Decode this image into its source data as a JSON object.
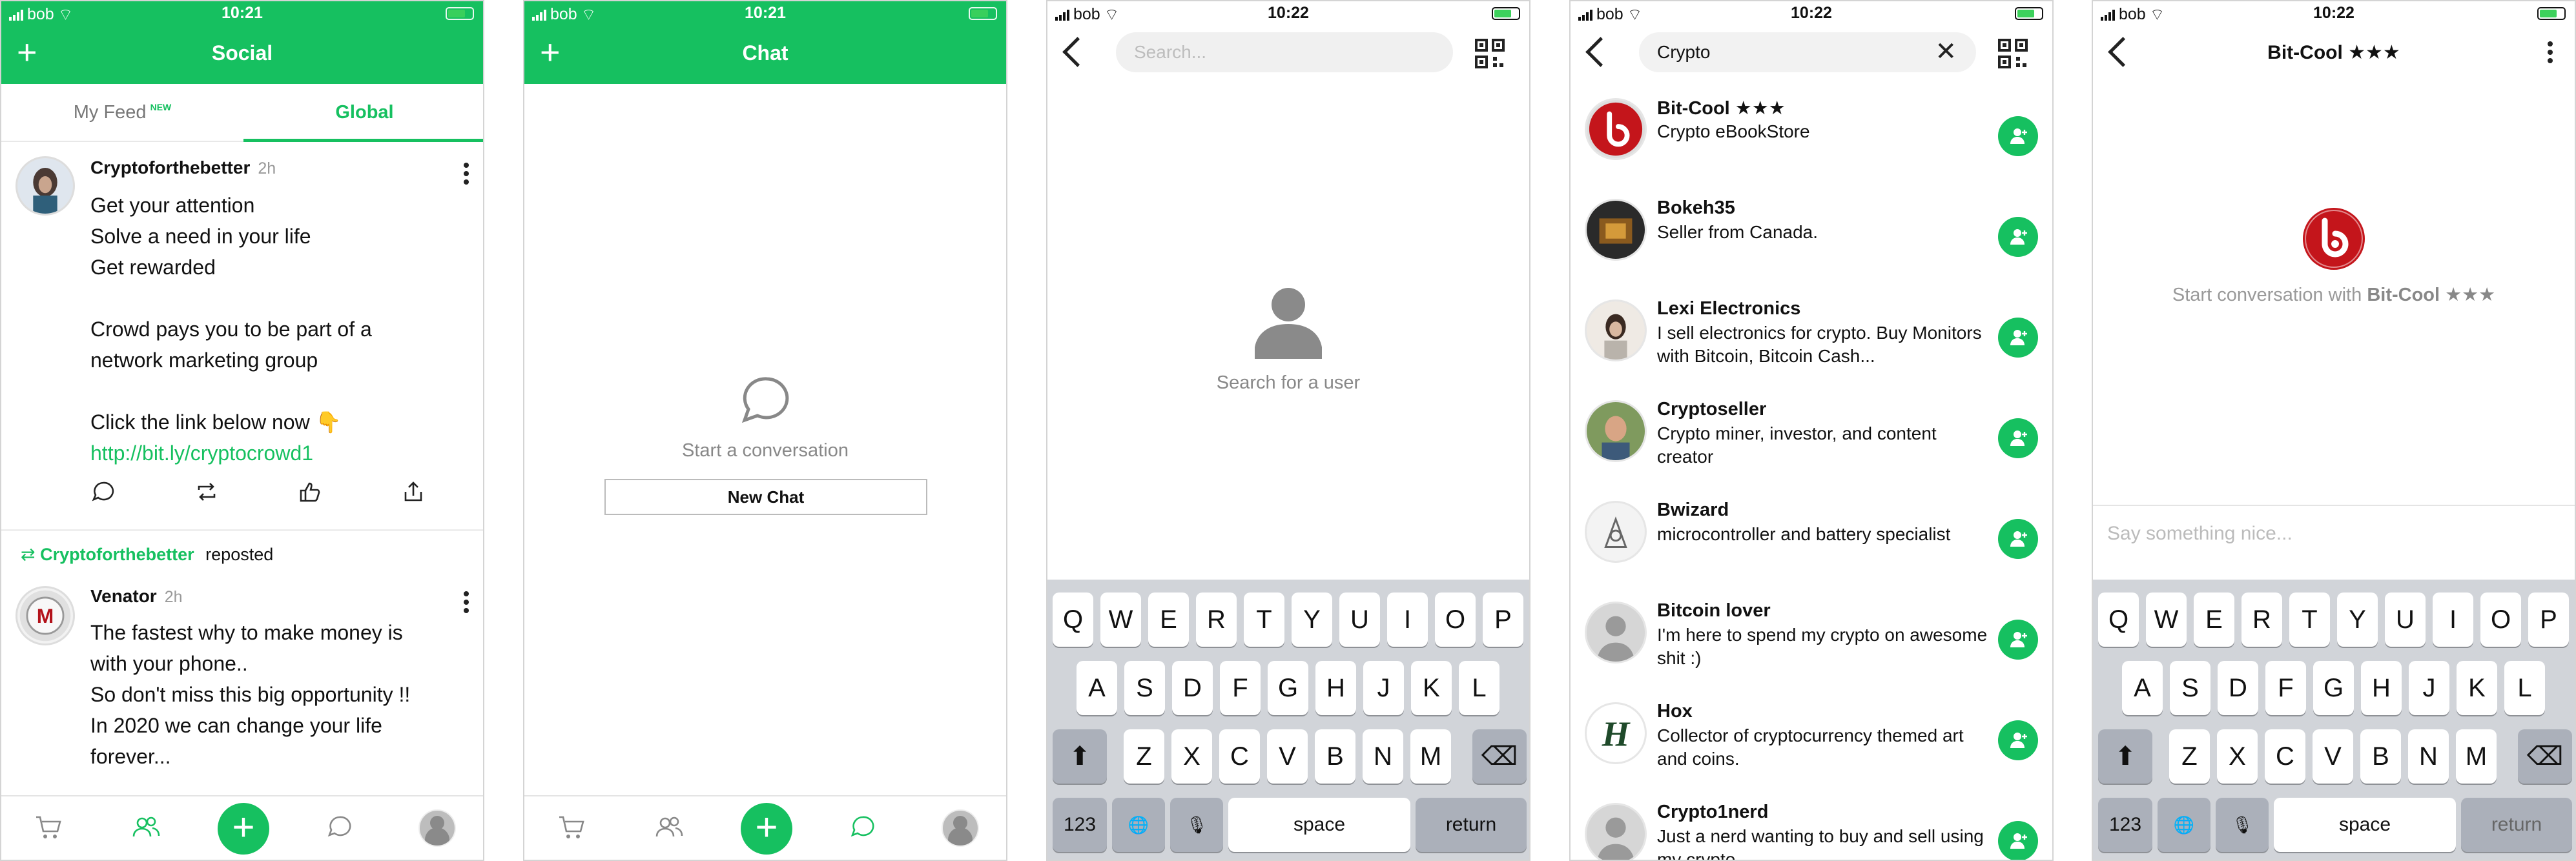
{
  "statusbar": {
    "carrier": "bob",
    "time_1": "10:21",
    "time_2": "10:21",
    "time_3": "10:22",
    "time_4": "10:22",
    "time_5": "10:22"
  },
  "social": {
    "title": "Social",
    "tab_my_feed": "My Feed",
    "tab_badge": "NEW",
    "tab_global": "Global",
    "posts": [
      {
        "author": "Cryptoforthebetter",
        "time": "2h",
        "text": "Get your attention\nSolve a need in your life\nGet rewarded\n\nCrowd pays you to be part of a\nnetwork marketing group\n\nClick the link below now 👇",
        "link": "http://bit.ly/cryptocrowd1"
      },
      {
        "repost_by": "Cryptoforthebetter",
        "repost_label": "reposted",
        "author": "Venator",
        "time": "2h",
        "text": "The fastest why to make money is\nwith your phone..\nSo don't miss this big opportunity !!\nIn 2020 we can change your life\nforever..."
      }
    ]
  },
  "chat": {
    "title": "Chat",
    "empty_message": "Start a conversation",
    "new_chat_button": "New Chat"
  },
  "search_empty": {
    "placeholder": "Search...",
    "empty_message": "Search for a user"
  },
  "search_results": {
    "query": "Crypto",
    "results": [
      {
        "name": "Bit-Cool ★★★",
        "desc": "Crypto eBookStore"
      },
      {
        "name": "Bokeh35",
        "desc": "Seller from Canada."
      },
      {
        "name": "Lexi Electronics",
        "desc": "I sell electronics for crypto. Buy Monitors with Bitcoin, Bitcoin Cash..."
      },
      {
        "name": "Cryptoseller",
        "desc": "Crypto miner, investor, and content creator"
      },
      {
        "name": "Bwizard",
        "desc": "microcontroller and battery specialist"
      },
      {
        "name": "Bitcoin lover",
        "desc": "I'm here to spend my crypto on awesome shit :)"
      },
      {
        "name": "Hox",
        "desc": "Collector of cryptocurrency themed art and coins."
      },
      {
        "name": "Crypto1nerd",
        "desc": "Just a nerd wanting to buy and sell using my crypto"
      }
    ]
  },
  "conversation": {
    "title": "Bit-Cool ★★★",
    "empty_prefix": "Start conversation with ",
    "empty_name": "Bit-Cool ★★★",
    "input_placeholder": "Say something nice..."
  },
  "keyboard": {
    "row1": [
      "Q",
      "W",
      "E",
      "R",
      "T",
      "Y",
      "U",
      "I",
      "O",
      "P"
    ],
    "row2": [
      "A",
      "S",
      "D",
      "F",
      "G",
      "H",
      "J",
      "K",
      "L"
    ],
    "row3": [
      "Z",
      "X",
      "C",
      "V",
      "B",
      "N",
      "M"
    ],
    "numbers": "123",
    "space": "space",
    "return": "return"
  },
  "colors": {
    "brand": "#16c060",
    "link": "#16c060"
  }
}
